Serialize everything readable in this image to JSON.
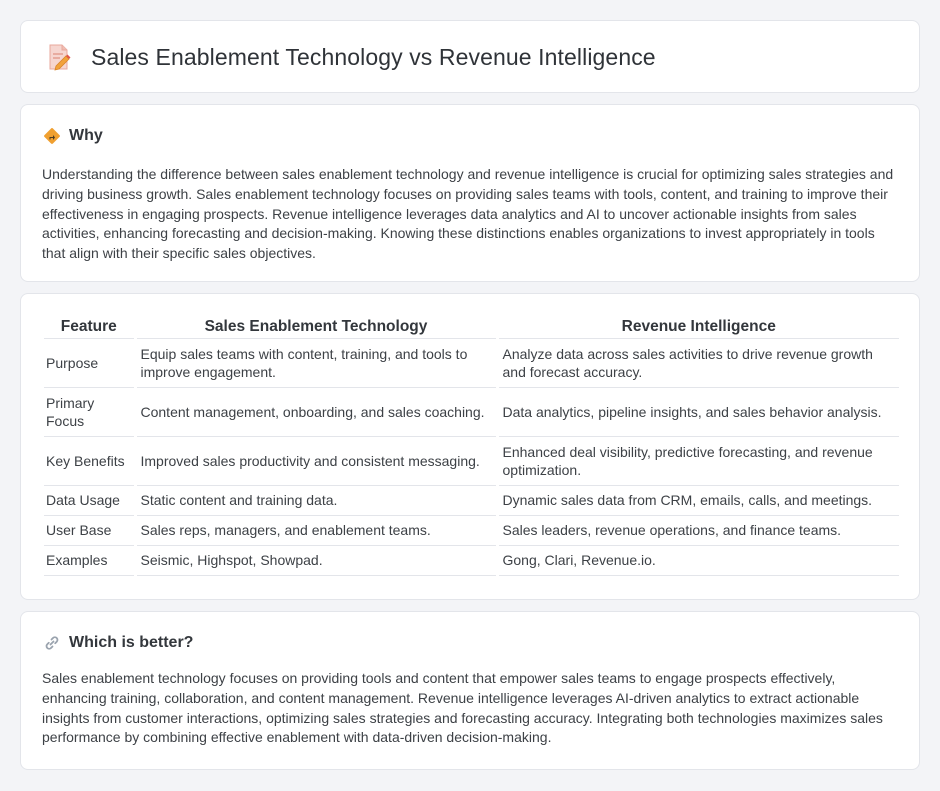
{
  "header": {
    "title": "Sales Enablement Technology vs Revenue Intelligence",
    "icon": "document-pencil-icon"
  },
  "why": {
    "title": "Why",
    "icon": "diamond-sign-icon",
    "text": "Understanding the difference between sales enablement technology and revenue intelligence is crucial for optimizing sales strategies and driving business growth. Sales enablement technology focuses on providing sales teams with tools, content, and training to improve their effectiveness in engaging prospects. Revenue intelligence leverages data analytics and AI to uncover actionable insights from sales activities, enhancing forecasting and decision-making. Knowing these distinctions enables organizations to invest appropriately in tools that align with their specific sales objectives."
  },
  "table": {
    "headers": [
      "Feature",
      "Sales Enablement Technology",
      "Revenue Intelligence"
    ],
    "rows": [
      [
        "Purpose",
        "Equip sales teams with content, training, and tools to improve engagement.",
        "Analyze data across sales activities to drive revenue growth and forecast accuracy."
      ],
      [
        "Primary Focus",
        "Content management, onboarding, and sales coaching.",
        "Data analytics, pipeline insights, and sales behavior analysis."
      ],
      [
        "Key Benefits",
        "Improved sales productivity and consistent messaging.",
        "Enhanced deal visibility, predictive forecasting, and revenue optimization."
      ],
      [
        "Data Usage",
        "Static content and training data.",
        "Dynamic sales data from CRM, emails, calls, and meetings."
      ],
      [
        "User Base",
        "Sales reps, managers, and enablement teams.",
        "Sales leaders, revenue operations, and finance teams."
      ],
      [
        "Examples",
        "Seismic, Highspot, Showpad.",
        "Gong, Clari, Revenue.io."
      ]
    ]
  },
  "better": {
    "title": "Which is better?",
    "icon": "link-icon",
    "text": "Sales enablement technology focuses on providing tools and content that empower sales teams to engage prospects effectively, enhancing training, collaboration, and content management. Revenue intelligence leverages AI-driven analytics to extract actionable insights from customer interactions, optimizing sales strategies and forecasting accuracy. Integrating both technologies maximizes sales performance by combining effective enablement with data-driven decision-making."
  },
  "colors": {
    "page_bg": "#f3f4f7",
    "card_bg": "#ffffff",
    "border": "#e3e5ea",
    "accent_orange": "#f0a030"
  }
}
